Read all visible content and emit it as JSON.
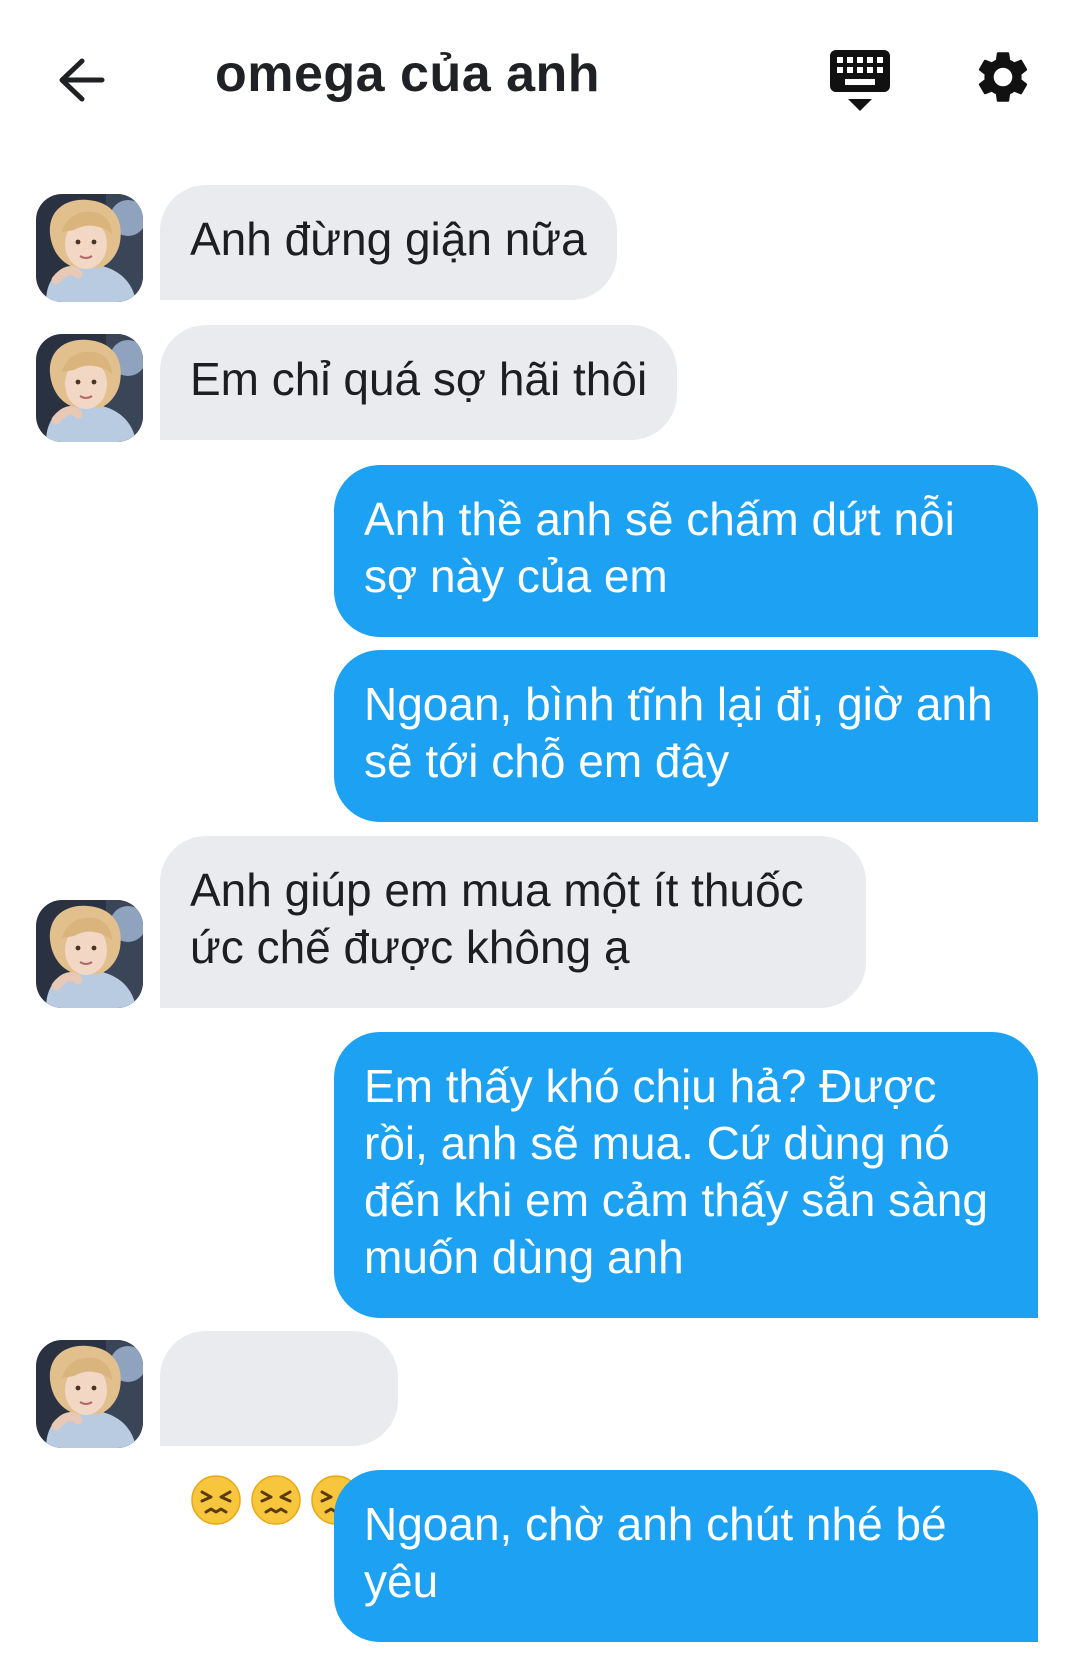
{
  "header": {
    "title": "omega của anh",
    "back_icon": "arrow-left-icon",
    "keyboard_icon": "keyboard-hide-icon",
    "settings_icon": "gear-icon"
  },
  "colors": {
    "incoming_bubble": "#e9ebee",
    "outgoing_bubble": "#1da1f2",
    "title_text": "#1f2124"
  },
  "messages": [
    {
      "sender": "them",
      "text": "Anh đừng giận nữa"
    },
    {
      "sender": "them",
      "text": "Em chỉ quá sợ hãi thôi"
    },
    {
      "sender": "me",
      "text": "Anh thề anh sẽ chấm dứt nỗi sợ này của em"
    },
    {
      "sender": "me",
      "text": "Ngoan, bình tĩnh lại đi, giờ anh sẽ tới chỗ em đây"
    },
    {
      "sender": "them",
      "text": "Anh giúp em mua một ít thuốc ức chế được không ạ"
    },
    {
      "sender": "me",
      "text": "Em thấy khó chịu hả? Được rồi, anh sẽ mua. Cứ dùng nó đến khi em cảm thấy sẵn sàng muốn dùng anh"
    },
    {
      "sender": "them",
      "text": "😣😣😣",
      "emoji": "persevering-face",
      "emoji_count": 3
    },
    {
      "sender": "me",
      "text": "Ngoan, chờ anh chút nhé bé yêu"
    }
  ]
}
